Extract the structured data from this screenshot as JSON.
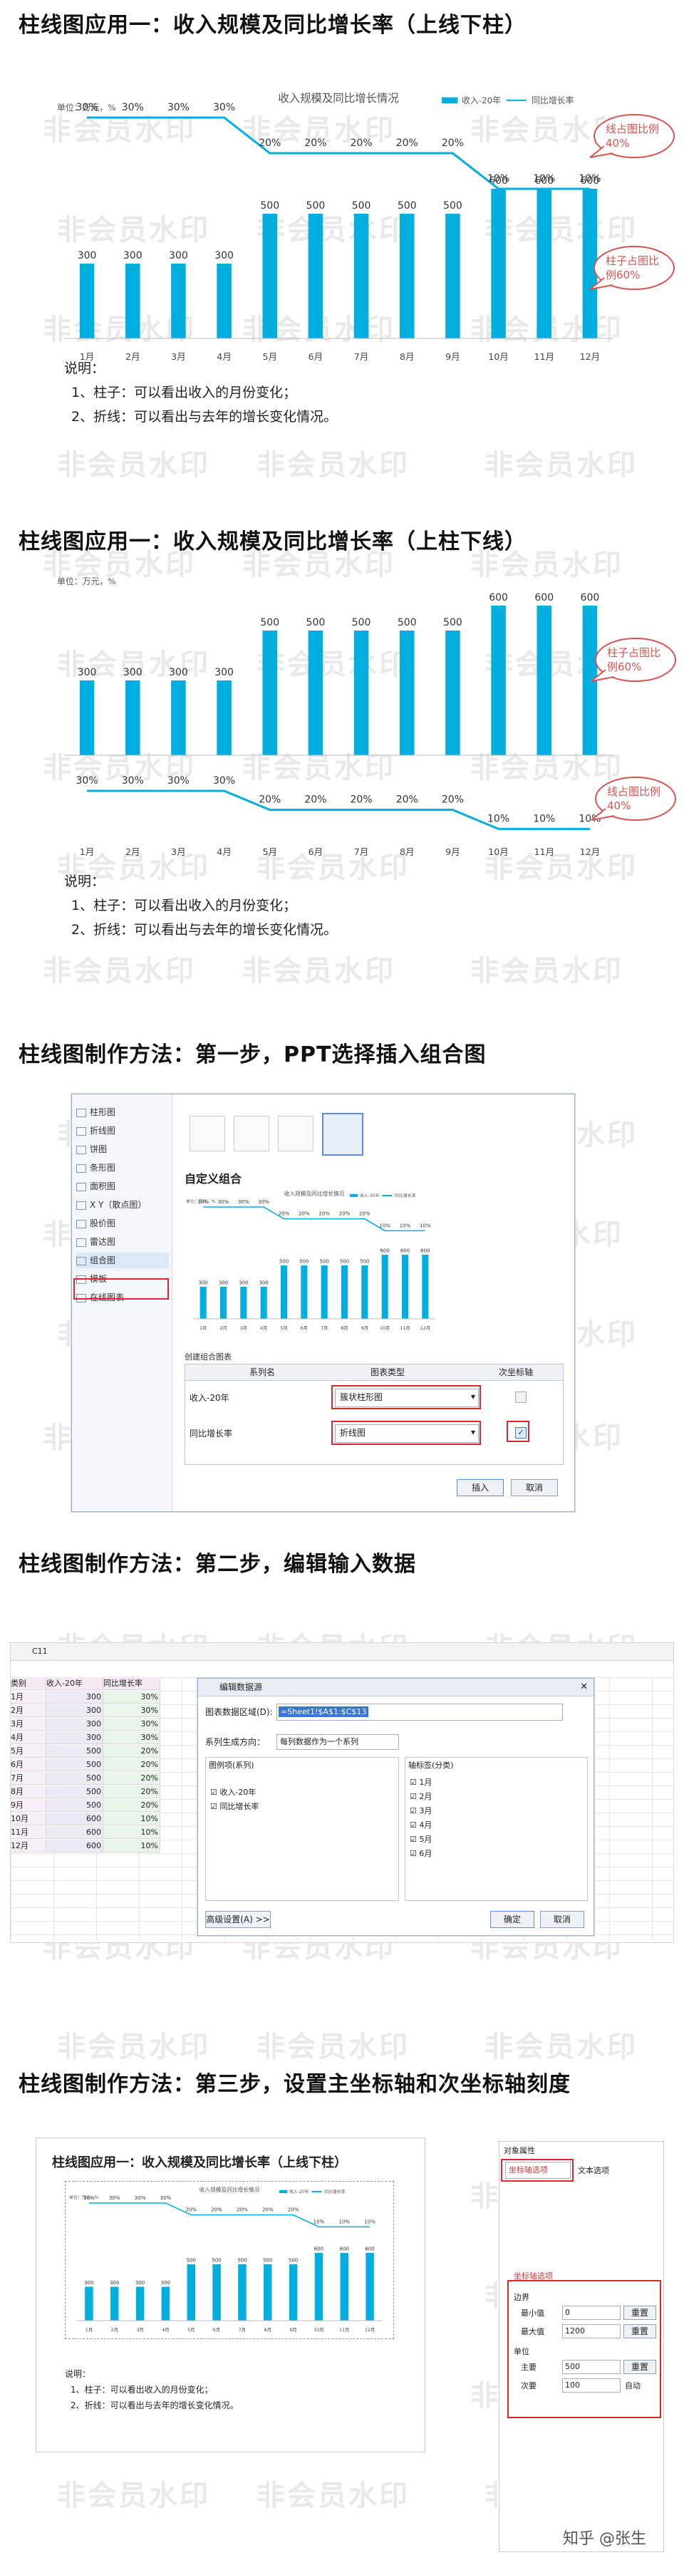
{
  "watermark": "非会员水印",
  "zhihu_credit": "知乎 @张生",
  "sections": {
    "s1": {
      "title": "柱线图应用一：收入规模及同比增长率（上线下柱）"
    },
    "s2": {
      "title": "柱线图应用一：收入规模及同比增长率（上柱下线）"
    },
    "s3": {
      "title": "柱线图制作方法：第一步，PPT选择插入组合图"
    },
    "s4": {
      "title": "柱线图制作方法：第二步，编辑输入数据"
    },
    "s5": {
      "title": "柱线图制作方法：第三步，设置主坐标轴和次坐标轴刻度"
    }
  },
  "notes": {
    "heading": "说明：",
    "line1": "1、柱子：可以看出收入的月份变化；",
    "line2": "2、折线：可以看出与去年的增长变化情况。"
  },
  "callouts": {
    "line_share": "线占图比例40%",
    "bar_share": "柱子占图比例60%"
  },
  "chart_data": [
    {
      "type": "bar+line",
      "title": "收入规模及同比增长情况",
      "unit_label": "单位：万元，%",
      "categories": [
        "1月",
        "2月",
        "3月",
        "4月",
        "5月",
        "6月",
        "7月",
        "8月",
        "9月",
        "10月",
        "11月",
        "12月"
      ],
      "series": [
        {
          "name": "收入-20年",
          "type": "bar",
          "color": "#00aee0",
          "values": [
            300,
            300,
            300,
            300,
            500,
            500,
            500,
            500,
            500,
            600,
            600,
            600
          ],
          "labels": [
            "300",
            "300",
            "300",
            "300",
            "500",
            "500",
            "500",
            "500",
            "500",
            "600",
            "600",
            "600"
          ]
        },
        {
          "name": "同比增长率",
          "type": "line",
          "color": "#00aee0",
          "values": [
            30,
            30,
            30,
            30,
            20,
            20,
            20,
            20,
            20,
            10,
            10,
            10
          ],
          "labels": [
            "30%",
            "30%",
            "30%",
            "30%",
            "20%",
            "20%",
            "20%",
            "20%",
            "20%",
            "10%",
            "10%",
            "10%"
          ]
        }
      ],
      "layout": "line-top-bars-bottom",
      "legend": "top-right"
    },
    {
      "type": "bar+line",
      "unit_label": "单位：万元，%",
      "categories": [
        "1月",
        "2月",
        "3月",
        "4月",
        "5月",
        "6月",
        "7月",
        "8月",
        "9月",
        "10月",
        "11月",
        "12月"
      ],
      "series": [
        {
          "type": "bar",
          "color": "#00aee0",
          "values": [
            300,
            300,
            300,
            300,
            500,
            500,
            500,
            500,
            500,
            600,
            600,
            600
          ],
          "labels": [
            "300",
            "300",
            "300",
            "300",
            "500",
            "500",
            "500",
            "500",
            "500",
            "600",
            "600",
            "600"
          ]
        },
        {
          "type": "line",
          "color": "#00aee0",
          "values": [
            30,
            30,
            30,
            30,
            20,
            20,
            20,
            20,
            20,
            10,
            10,
            10
          ],
          "labels": [
            "30%",
            "30%",
            "30%",
            "30%",
            "20%",
            "20%",
            "20%",
            "20%",
            "20%",
            "10%",
            "10%",
            "10%"
          ]
        }
      ],
      "layout": "bars-top-line-bottom"
    }
  ],
  "insert_dialog": {
    "sidebar": [
      "柱形图",
      "折线图",
      "饼图",
      "条形图",
      "面积图",
      "X Y（散点图）",
      "股价图",
      "雷达图",
      "组合图",
      "模板",
      "在线图表"
    ],
    "selected": "组合图",
    "section_title": "自定义组合",
    "create_label": "创建组合图表",
    "col_series": "系列名",
    "col_type": "图表类型",
    "col_axis": "次坐标轴",
    "rows": [
      {
        "name": "收入-20年",
        "type": "簇状柱形图"
      },
      {
        "name": "同比增长率",
        "type": "折线图"
      }
    ],
    "insert_btn": "插入",
    "cancel_btn": "取消"
  },
  "sheet": {
    "cellref": "C11",
    "headers": [
      "类别",
      "收入-20年",
      "同比增长率"
    ],
    "rows": [
      [
        "1月",
        "300",
        "30%"
      ],
      [
        "2月",
        "300",
        "30%"
      ],
      [
        "3月",
        "300",
        "30%"
      ],
      [
        "4月",
        "300",
        "30%"
      ],
      [
        "5月",
        "500",
        "20%"
      ],
      [
        "6月",
        "500",
        "20%"
      ],
      [
        "7月",
        "500",
        "20%"
      ],
      [
        "8月",
        "500",
        "20%"
      ],
      [
        "9月",
        "500",
        "20%"
      ],
      [
        "10月",
        "600",
        "10%"
      ],
      [
        "11月",
        "600",
        "10%"
      ],
      [
        "12月",
        "600",
        "10%"
      ]
    ]
  },
  "data_dialog": {
    "title": "编辑数据源",
    "range_label": "图表数据区域(D):",
    "range_value": "=Sheet1!$A$1:$C$13",
    "series_by_label": "系列生成方向：",
    "series_by_value": "每列数据作为一个系列",
    "series_label": "图例项(系列)",
    "series_items": [
      "收入-20年",
      "同比增长率"
    ],
    "axis_label": "轴标签(分类)",
    "axis_items": [
      "1月",
      "2月",
      "3月",
      "4月",
      "5月",
      "6月"
    ],
    "advanced": "高级设置(A) >>",
    "ok": "确定",
    "cancel": "取消"
  },
  "format_panel": {
    "title": "对象属性",
    "tab1": "坐标轴选项",
    "tab2": "文本选项",
    "group": "坐标轴选项",
    "bounds": "边界",
    "min_label": "最小值",
    "min_value": "0",
    "max_label": "最大值",
    "max_value": "1200",
    "units": "单位",
    "major_label": "主要",
    "major_value": "500",
    "minor_label": "次要",
    "minor_value": "100",
    "reset": "重置",
    "auto": "自动"
  }
}
